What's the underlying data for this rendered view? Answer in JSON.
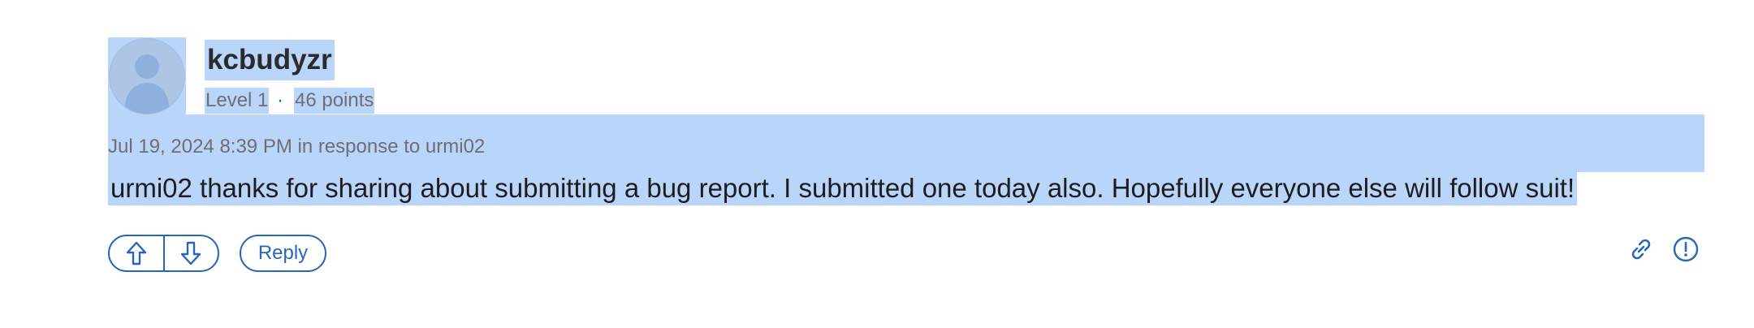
{
  "author": {
    "username": "kcbudyzr",
    "level": "Level 1",
    "separator": "·",
    "points": "46 points",
    "avatar_icon": "avatar-silhouette-icon"
  },
  "post": {
    "meta": "Jul 19, 2024 8:39 PM in response to urmi02",
    "body": "urmi02 thanks for sharing about submitting a bug report. I submitted one today also. Hopefully everyone else will follow suit!"
  },
  "actions": {
    "upvote_icon": "arrow-up-icon",
    "downvote_icon": "arrow-down-icon",
    "reply_label": "Reply",
    "link_icon": "link-icon",
    "report_icon": "exclamation-circle-icon"
  },
  "colors": {
    "selection": "#b9d5fa",
    "accent": "#2a66b8",
    "muted_text": "#6e6e73"
  }
}
